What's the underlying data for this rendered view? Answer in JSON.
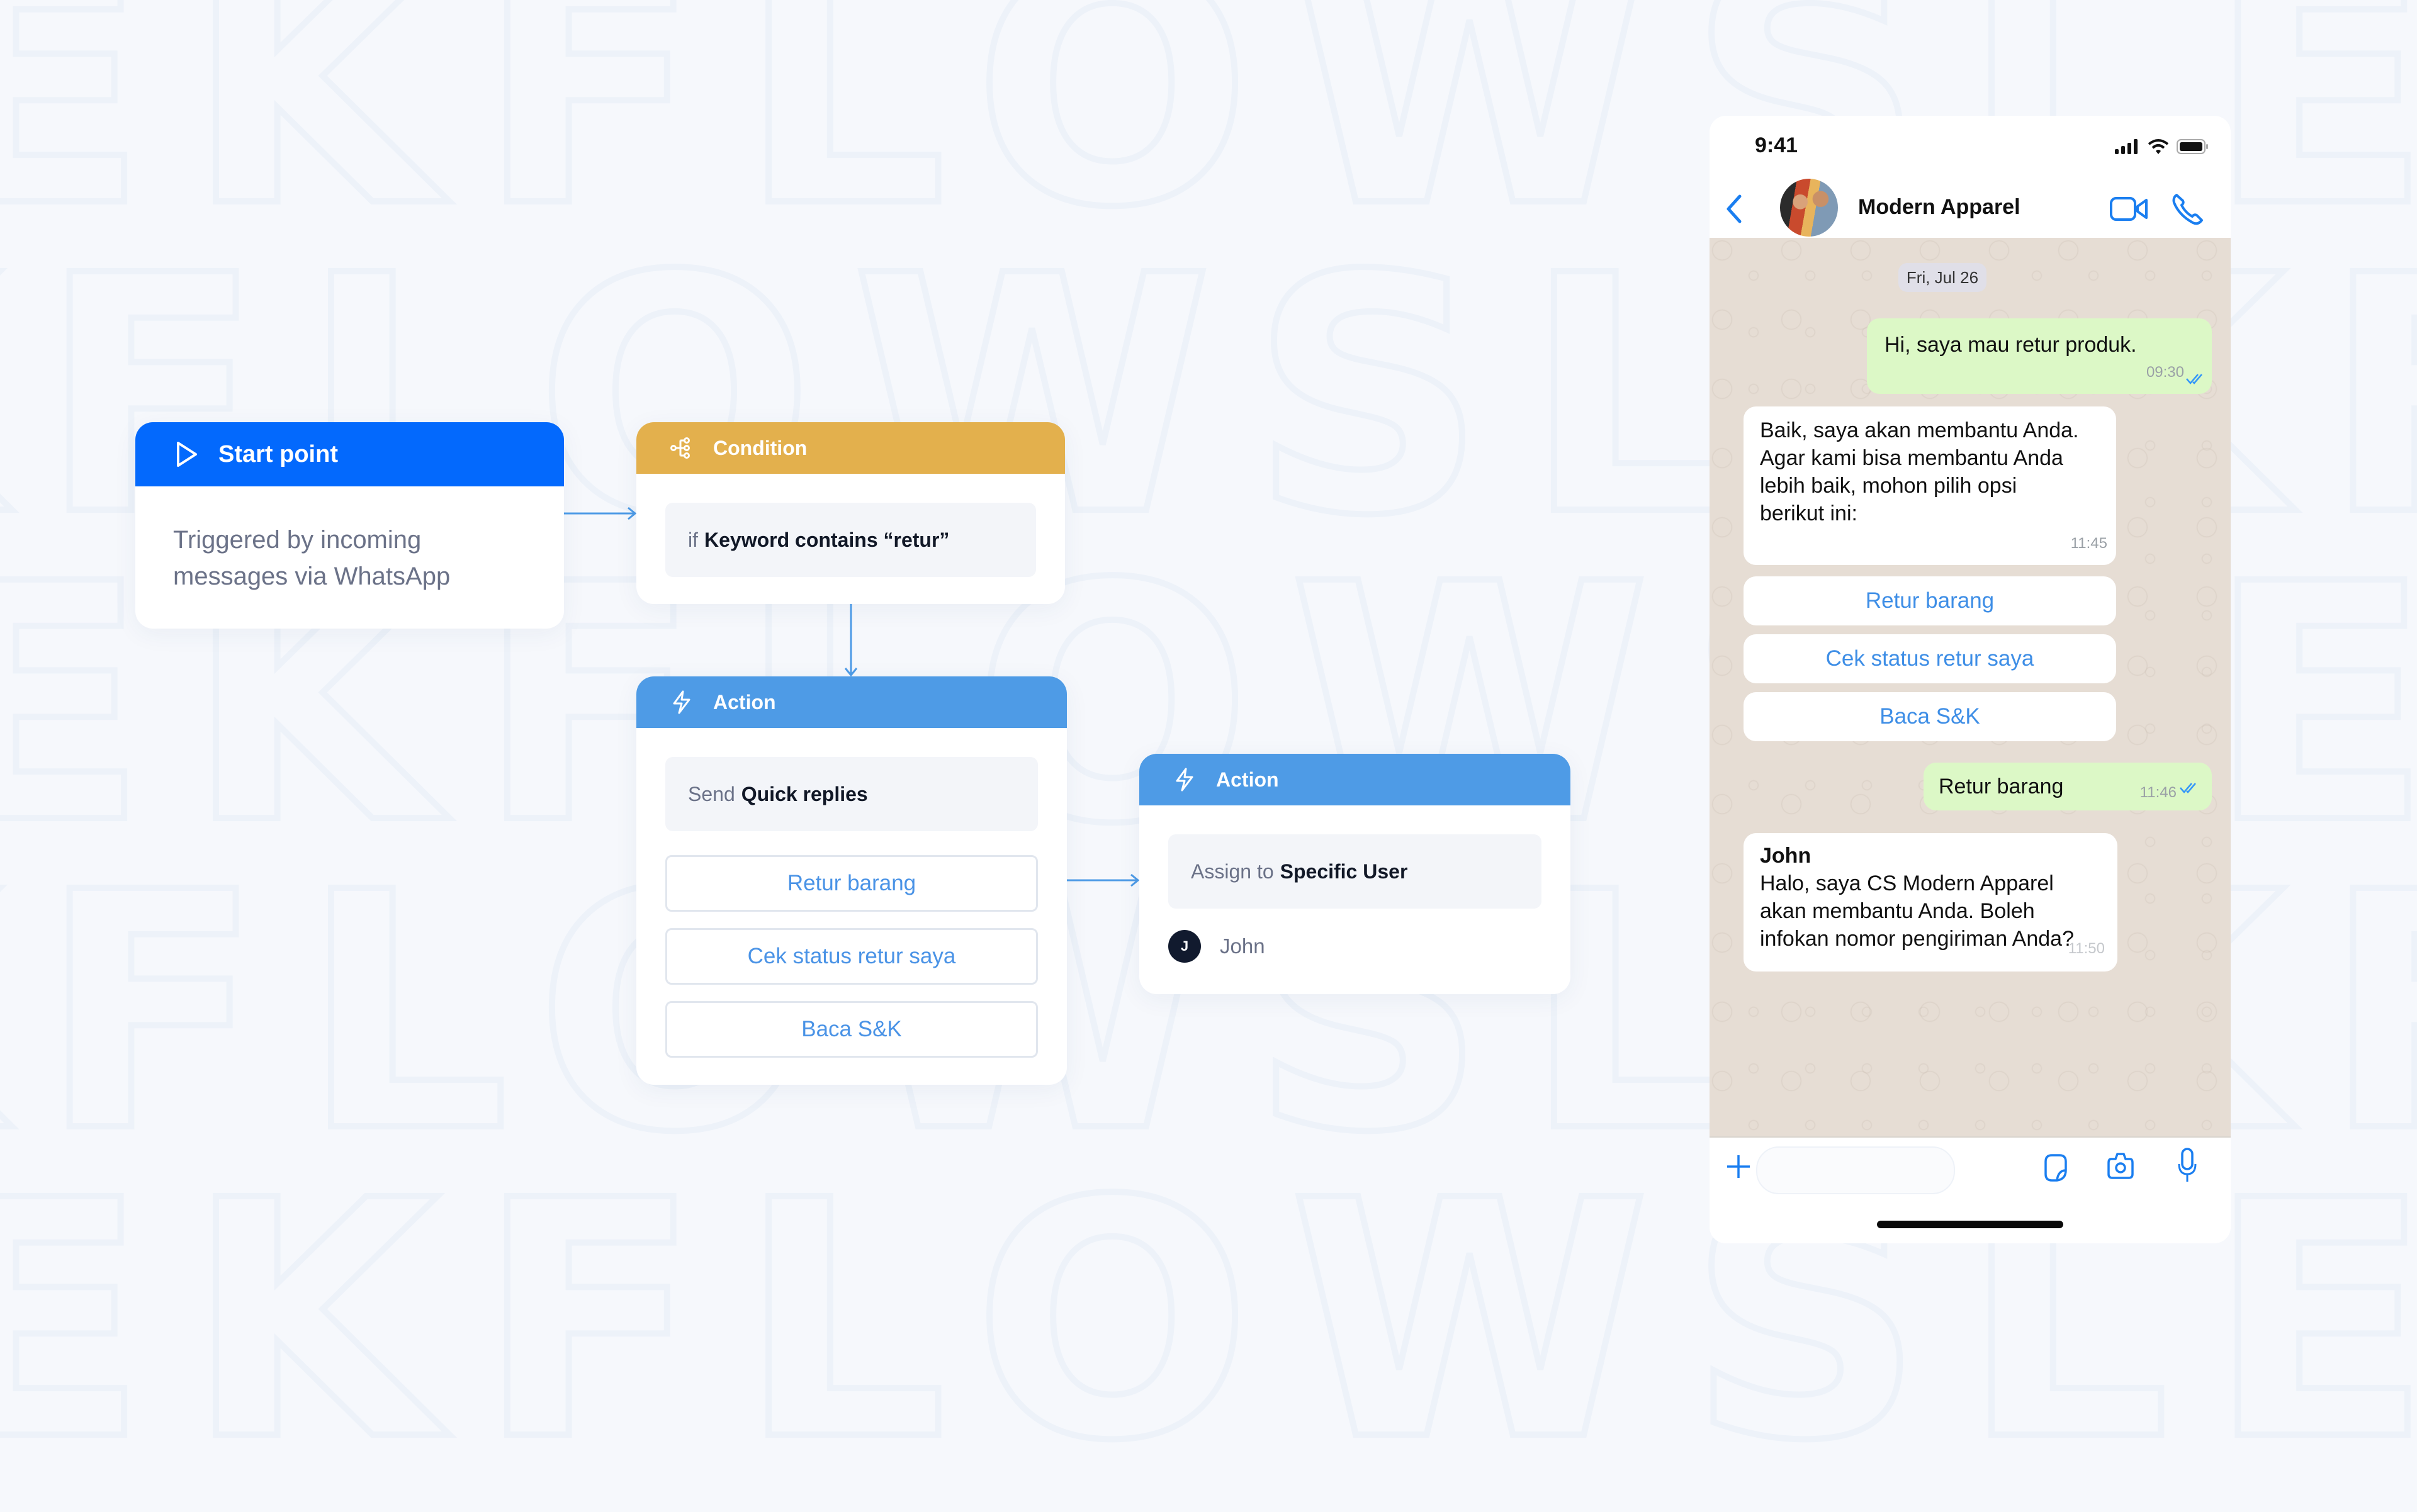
{
  "background": {
    "watermark_rows": [
      "EKFLOWSLEK",
      "KFLOWSLEKF",
      "EKFLOWSLEK",
      "KFLOWSLEKF",
      "EKFLOWSLEK"
    ],
    "color": "#f6f8fc"
  },
  "flow": {
    "start": {
      "title": "Start point",
      "icon": "play-icon",
      "description_line1": "Triggered by incoming",
      "description_line2": "messages via WhatsApp",
      "color": "#0369fd"
    },
    "condition": {
      "title": "Condition",
      "icon": "branch-icon",
      "prefix": "if",
      "rule": "Keyword contains “retur”",
      "color": "#e3b04d"
    },
    "action_quick_replies": {
      "title": "Action",
      "icon": "lightning-icon",
      "prefix": "Send",
      "action": "Quick replies",
      "replies": [
        "Retur barang",
        "Cek status retur saya",
        "Baca S&K"
      ],
      "color": "#4e9be6"
    },
    "action_assign": {
      "title": "Action",
      "icon": "lightning-icon",
      "prefix": "Assign to",
      "action": "Specific User",
      "user_initial": "J",
      "user_name": "John",
      "color": "#4e9be6"
    }
  },
  "phone": {
    "status_time": "9:41",
    "contact_name": "Modern Apparel",
    "date_label": "Fri, Jul 26",
    "messages": [
      {
        "direction": "out",
        "text": "Hi, saya mau retur produk.",
        "time": "09:30",
        "read": true
      },
      {
        "direction": "in",
        "lines": [
          "Baik, saya akan membantu Anda.",
          "Agar kami bisa membantu Anda",
          "lebih baik, mohon pilih opsi",
          "berikut ini:"
        ],
        "time": "11:45"
      },
      {
        "direction": "out",
        "text": "Retur barang",
        "time": "11:46",
        "read": true
      },
      {
        "direction": "in",
        "sender": "John",
        "lines": [
          "Halo, saya CS Modern Apparel",
          "akan membantu Anda. Boleh",
          "infokan nomor pengiriman Anda?"
        ],
        "time": "11:50"
      }
    ],
    "quick_replies": [
      "Retur barang",
      "Cek status retur saya",
      "Baca S&K"
    ],
    "composer": {
      "input_value": "",
      "accent": "#1a7ef0"
    }
  }
}
